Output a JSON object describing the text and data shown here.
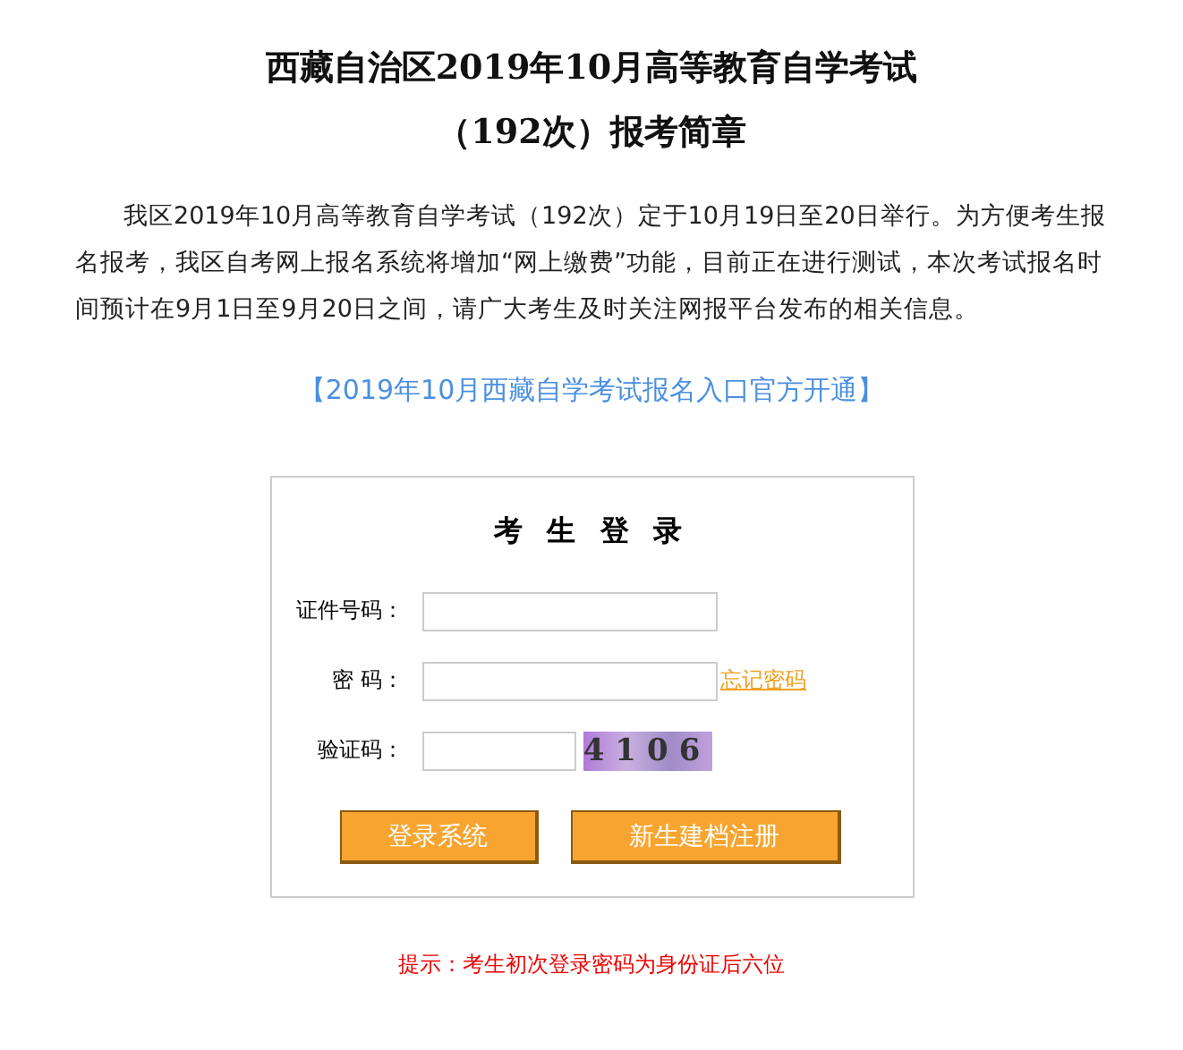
{
  "title_lines": [
    "西藏自治区2019年10月高等教育自学考试",
    "（192次）报考简章"
  ],
  "intro": "我区2019年10月高等教育自学考试（192次）定于10月19日至20日举行。为方便考生报名报考，我区自考网上报名系统将增加“网上缴费”功能，目前正在进行测试，本次考试报名时间预计在9月1日至9月20日之间，请广大考生及时关注网报平台发布的相关信息。",
  "entry_link": "【2019年10月西藏自学考试报名入口官方开通】",
  "login": {
    "heading": "考 生 登 录",
    "fields": [
      {
        "kind": "text",
        "label": "证件号码："
      },
      {
        "kind": "password",
        "label": "密 码：",
        "link": "忘记密码"
      },
      {
        "kind": "captcha",
        "label": "验证码：",
        "captcha": "4106"
      }
    ],
    "buttons": [
      "登录系统",
      "新生建档注册"
    ]
  },
  "tip": "提示：考生初次登录密码为身份证后六位"
}
